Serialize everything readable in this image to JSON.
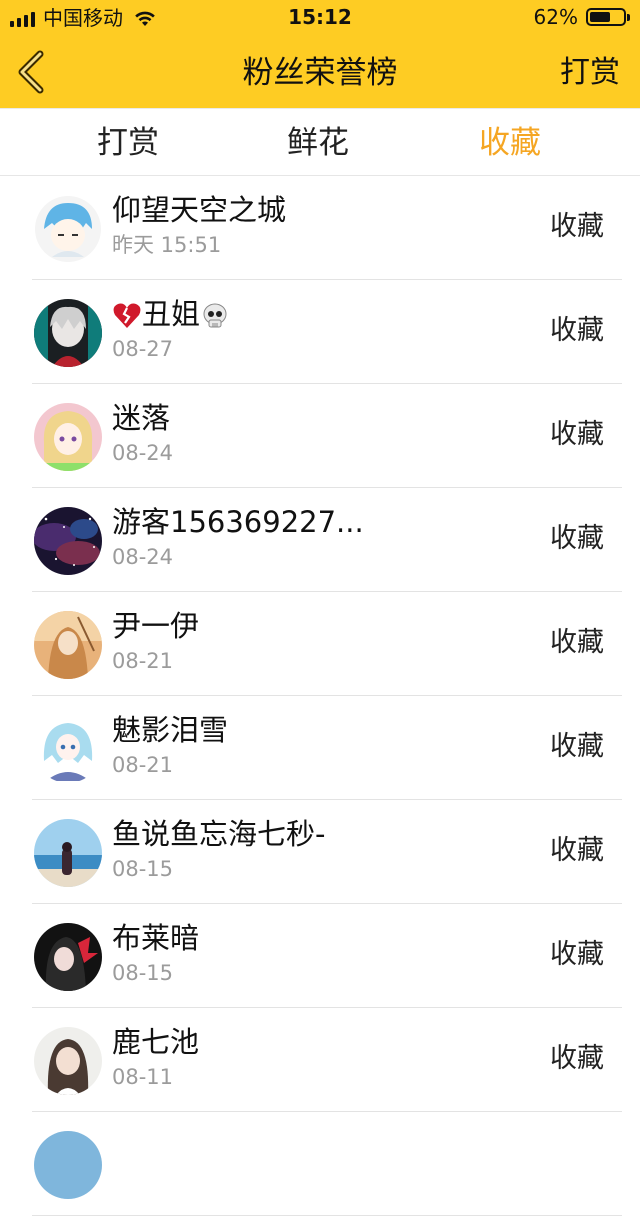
{
  "status_bar": {
    "carrier": "中国移动",
    "time": "15:12",
    "battery_percent": "62%",
    "battery_level": 0.62
  },
  "header": {
    "title": "粉丝荣誉榜",
    "action": "打赏",
    "back_icon": "chevron-left-icon"
  },
  "tabs": [
    {
      "label": "打赏",
      "active": false
    },
    {
      "label": "鲜花",
      "active": false
    },
    {
      "label": "收藏",
      "active": true
    }
  ],
  "colors": {
    "accent": "#fecc23",
    "active_tab": "#f5a623"
  },
  "fans": [
    {
      "name": "仰望天空之城",
      "date": "昨天 15:51",
      "action": "收藏"
    },
    {
      "name": "丑姐",
      "date": "08-27",
      "action": "收藏",
      "prefix_icon": "broken-heart-icon",
      "suffix_icon": "skull-icon"
    },
    {
      "name": "迷落",
      "date": "08-24",
      "action": "收藏"
    },
    {
      "name": "游客156369227...",
      "date": "08-24",
      "action": "收藏"
    },
    {
      "name": "尹一伊",
      "date": "08-21",
      "action": "收藏"
    },
    {
      "name": "魅影泪雪",
      "date": "08-21",
      "action": "收藏"
    },
    {
      "name": "鱼说鱼忘海七秒-",
      "date": "08-15",
      "action": "收藏"
    },
    {
      "name": "布莱暗",
      "date": "08-15",
      "action": "收藏"
    },
    {
      "name": "鹿七池",
      "date": "08-11",
      "action": "收藏"
    }
  ]
}
